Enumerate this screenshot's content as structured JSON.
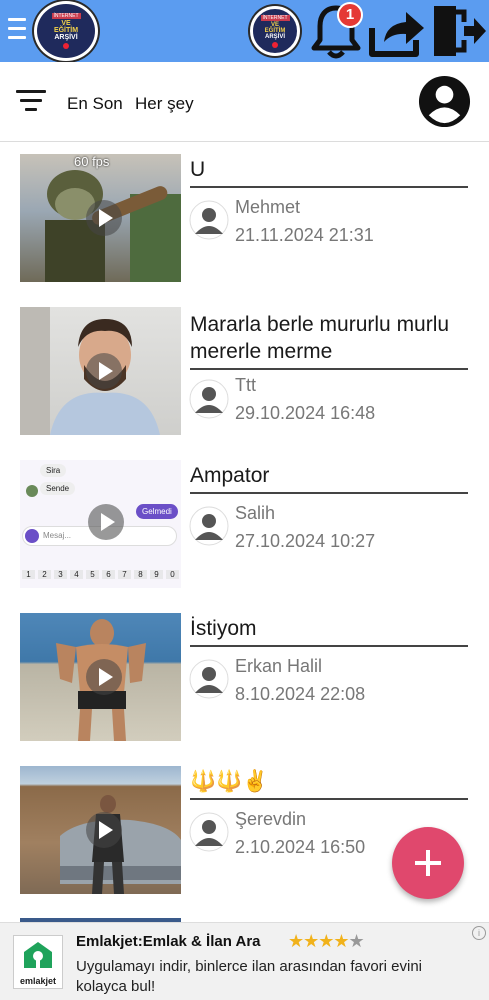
{
  "header": {
    "notification_count": "1",
    "logo_lines": [
      "İNTERNET",
      "VE",
      "EĞİTİM",
      "ARŞİVİ"
    ]
  },
  "filter": {
    "sort_label": "En Son",
    "scope_label": "Her şey"
  },
  "posts": [
    {
      "title": "U",
      "author": "Mehmet",
      "date": "21.11.2024 21:31",
      "overlay": "60 fps"
    },
    {
      "title": "Mararla berle mururlu murlu mererle merme",
      "author": "Ttt",
      "date": "29.10.2024 16:48"
    },
    {
      "title": "Ampator",
      "author": "Salih",
      "date": "27.10.2024 10:27"
    },
    {
      "title": "İstiyom",
      "author": "Erkan Halil",
      "date": "8.10.2024 22:08"
    },
    {
      "title": "🔱🔱✌️",
      "author": "Şerevdin",
      "date": "2.10.2024 16:50"
    }
  ],
  "chat_mock": {
    "bubble1": "Sira",
    "bubble2": "Sende",
    "bubble3": "Gelmedi",
    "input_placeholder": "Mesaj...",
    "keys": [
      "1",
      "2",
      "3",
      "4",
      "5",
      "6",
      "7",
      "8",
      "9",
      "0"
    ]
  },
  "ad": {
    "title": "Emlakjet:Emlak & İlan Ara",
    "rating": 4.5,
    "description": "Uygulamayı indir, binlerce ilan arasından favori evini kolayca bul!",
    "logo_text": "emlakjet"
  },
  "colors": {
    "topbar": "#5b9cf0",
    "fab": "#e0486d",
    "badge": "#e53935"
  }
}
